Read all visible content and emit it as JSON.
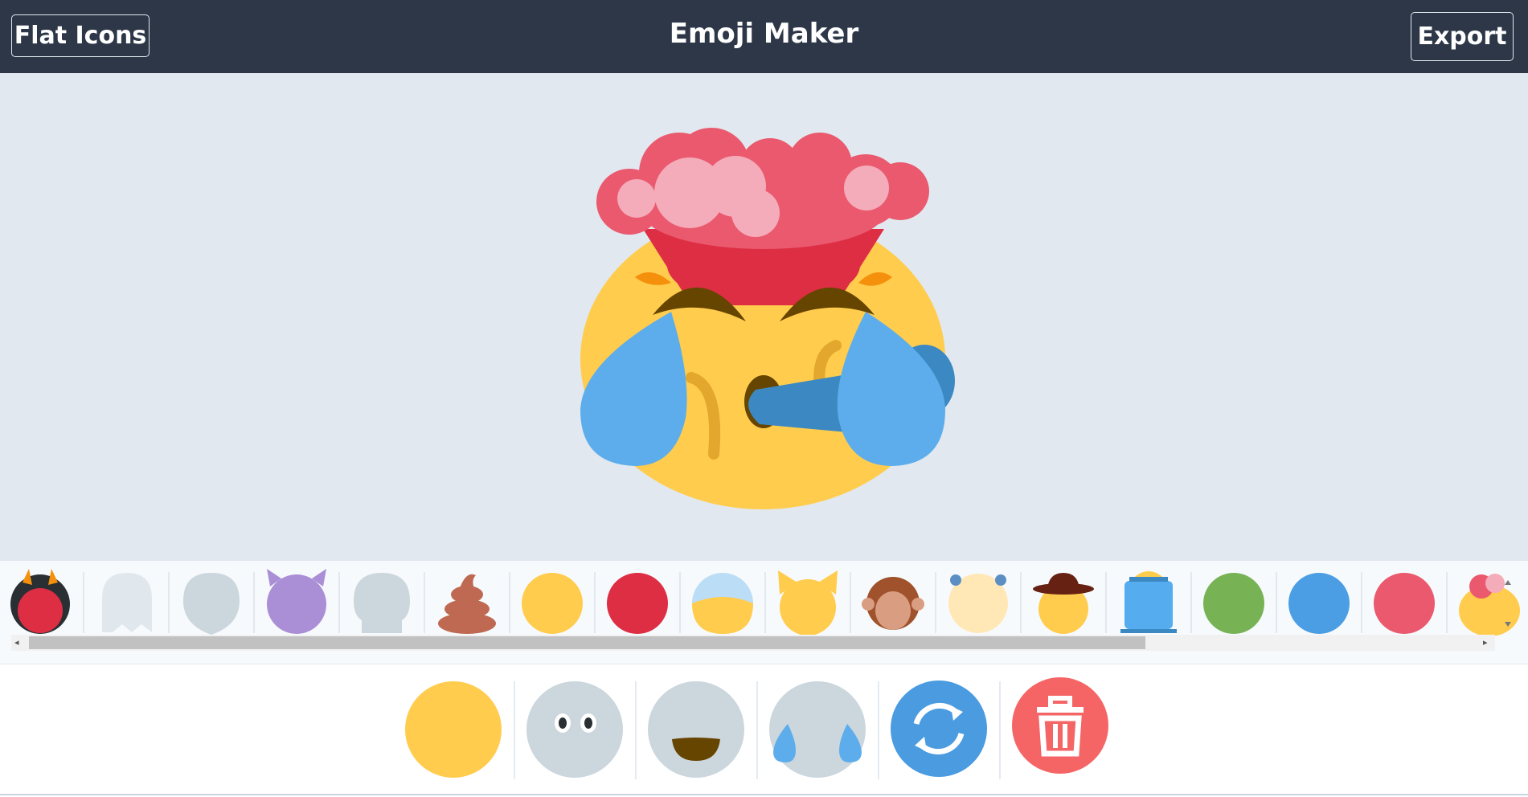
{
  "header": {
    "left_button": "Flat Icons",
    "title": "Emoji Maker",
    "right_button": "Export"
  },
  "canvas": {
    "preview": "exploding-head face with tears and nose"
  },
  "picker": {
    "items": [
      "ogre-icon",
      "ghost-icon",
      "alien-icon",
      "devil-icon",
      "skull-icon",
      "poop-icon",
      "yellow-face-icon",
      "red-face-icon",
      "cold-face-icon",
      "cat-face-icon",
      "monkey-face-icon",
      "baby-face-icon",
      "cowboy-face-icon",
      "robot-face-icon",
      "green-face-icon",
      "blue-face-icon",
      "pink-face-icon",
      "exploding-head-icon"
    ]
  },
  "toolbar": {
    "items": [
      "face-base-icon",
      "eyes-icon",
      "mouth-icon",
      "tears-icon",
      "randomize-icon",
      "delete-icon"
    ]
  },
  "colors": {
    "header_bg": "#2d3748",
    "canvas_bg": "#e2e8f0",
    "face_yellow": "#ffcc4d",
    "tear_blue": "#5dadec",
    "accent_blue": "#4299e1",
    "danger_red": "#f56565"
  }
}
